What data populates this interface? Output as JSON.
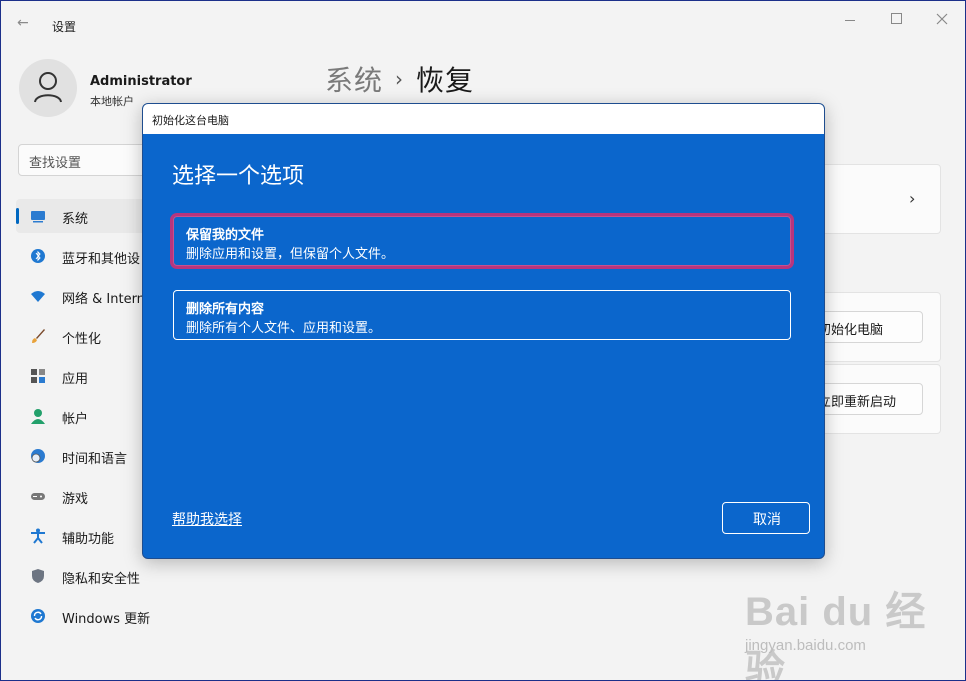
{
  "window": {
    "title": "设置",
    "back_glyph": "←"
  },
  "user": {
    "name": "Administrator",
    "account_type": "本地帐户"
  },
  "search": {
    "placeholder": "查找设置"
  },
  "nav": {
    "items": [
      {
        "label": "系统",
        "icon": "monitor-icon",
        "active": true
      },
      {
        "label": "蓝牙和其他设",
        "icon": "bluetooth-icon"
      },
      {
        "label": "网络 & Intern",
        "icon": "wifi-icon"
      },
      {
        "label": "个性化",
        "icon": "brush-icon"
      },
      {
        "label": "应用",
        "icon": "apps-icon"
      },
      {
        "label": "帐户",
        "icon": "person-icon"
      },
      {
        "label": "时间和语言",
        "icon": "clock-globe-icon"
      },
      {
        "label": "游戏",
        "icon": "gamepad-icon"
      },
      {
        "label": "辅助功能",
        "icon": "accessibility-icon"
      },
      {
        "label": "隐私和安全性",
        "icon": "shield-icon"
      },
      {
        "label": "Windows 更新",
        "icon": "update-icon"
      }
    ]
  },
  "breadcrumb": {
    "parent": "系统",
    "separator": "›",
    "current": "恢复"
  },
  "content": {
    "reset_button": "初始化电脑",
    "restart_button": "立即重新启动"
  },
  "dialog": {
    "title": "初始化这台电脑",
    "heading": "选择一个选项",
    "options": [
      {
        "title": "保留我的文件",
        "desc": "删除应用和设置，但保留个人文件。"
      },
      {
        "title": "删除所有内容",
        "desc": "删除所有个人文件、应用和设置。"
      }
    ],
    "help_link": "帮助我选择",
    "cancel": "取消"
  },
  "watermark": {
    "brand": "Bai du 经验",
    "url": "jingyan.baidu.com"
  },
  "colors": {
    "dialog_bg": "#0b66cc",
    "accent": "#0067c0",
    "highlight": "#b7357e"
  }
}
